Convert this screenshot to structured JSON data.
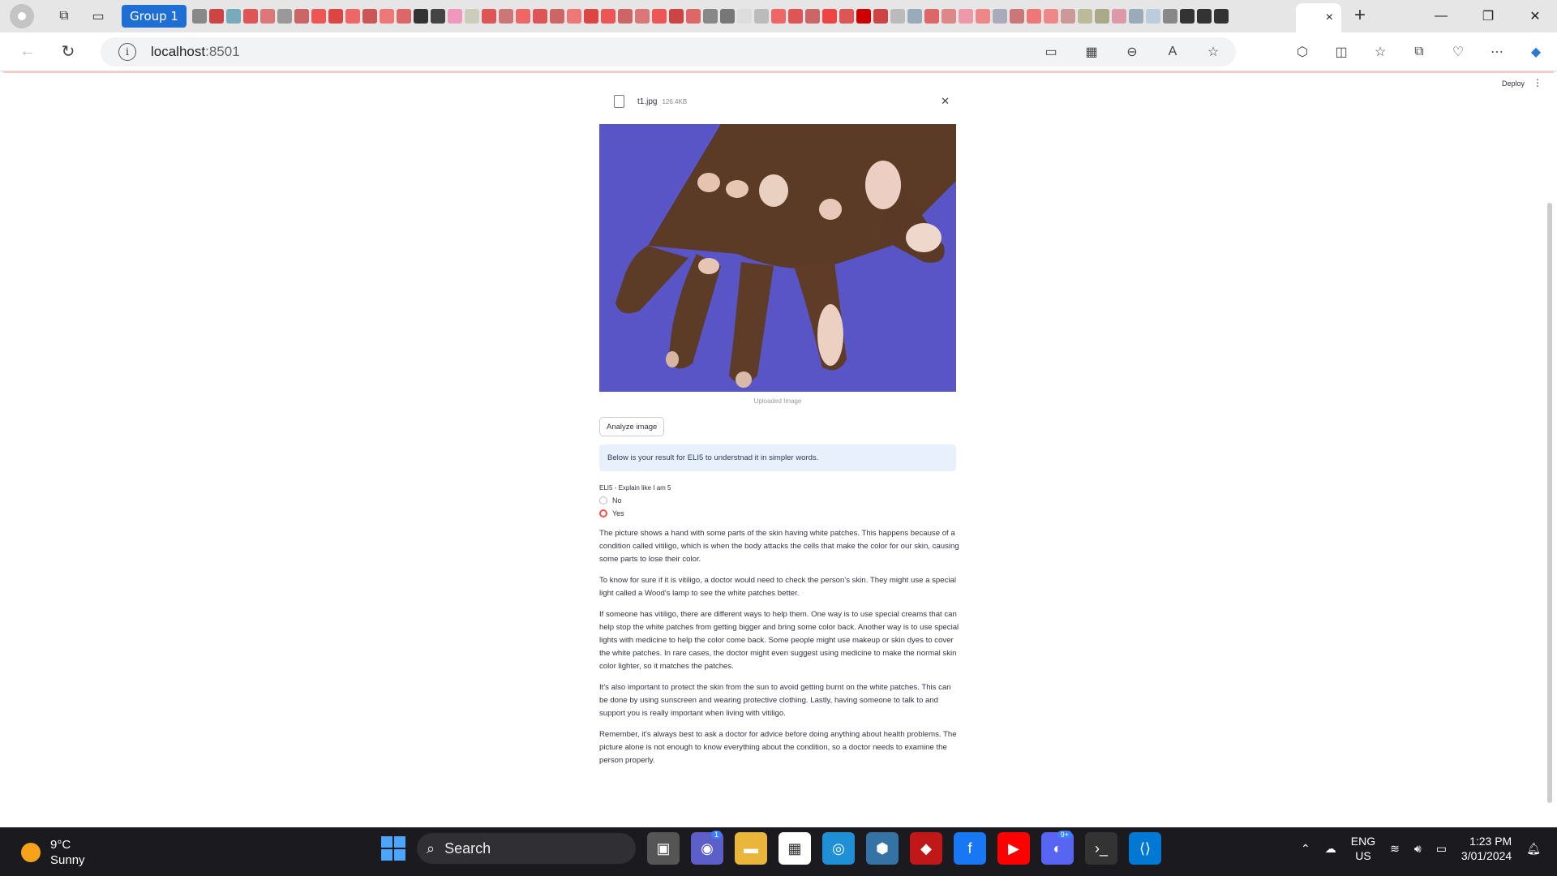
{
  "browser": {
    "tab_group_label": "Group 1",
    "active_tab_close": "×",
    "new_tab": "+",
    "window_controls": [
      "—",
      "❐",
      "✕"
    ],
    "url_host": "localhost",
    "url_port": ":8501"
  },
  "app": {
    "deploy_label": "Deploy",
    "file": {
      "name": "t1.jpg",
      "size": "126.4KB"
    },
    "image_caption": "Uploaded Image",
    "analyze_button": "Analyze image",
    "info_message": "Below is your result for ELI5 to understnad it in simpler words.",
    "eli5": {
      "label": "ELI5 - Explain like I am 5",
      "options": [
        "No",
        "Yes"
      ],
      "selected": "Yes"
    },
    "result_paragraphs": [
      "The picture shows a hand with some parts of the skin having white patches. This happens because of a condition called vitiligo, which is when the body attacks the cells that make the color for our skin, causing some parts to lose their color.",
      "To know for sure if it is vitiligo, a doctor would need to check the person's skin. They might use a special light called a Wood's lamp to see the white patches better.",
      "If someone has vitiligo, there are different ways to help them. One way is to use special creams that can help stop the white patches from getting bigger and bring some color back. Another way is to use special lights with medicine to help the color come back. Some people might use makeup or skin dyes to cover the white patches. In rare cases, the doctor might even suggest using medicine to make the normal skin color lighter, so it matches the patches.",
      "It's also important to protect the skin from the sun to avoid getting burnt on the white patches. This can be done by using sunscreen and wearing protective clothing. Lastly, having someone to talk to and support you is really important when living with vitiligo.",
      "Remember, it's always best to ask a doctor for advice before doing anything about health problems. The picture alone is not enough to know everything about the condition, so a doctor needs to examine the person properly."
    ]
  },
  "taskbar": {
    "weather_temp": "9°C",
    "weather_desc": "Sunny",
    "search_placeholder": "Search",
    "lang_primary": "ENG",
    "lang_secondary": "US",
    "time": "1:23 PM",
    "date": "3/01/2024",
    "teams_badge": "1",
    "discord_badge": "9+"
  }
}
